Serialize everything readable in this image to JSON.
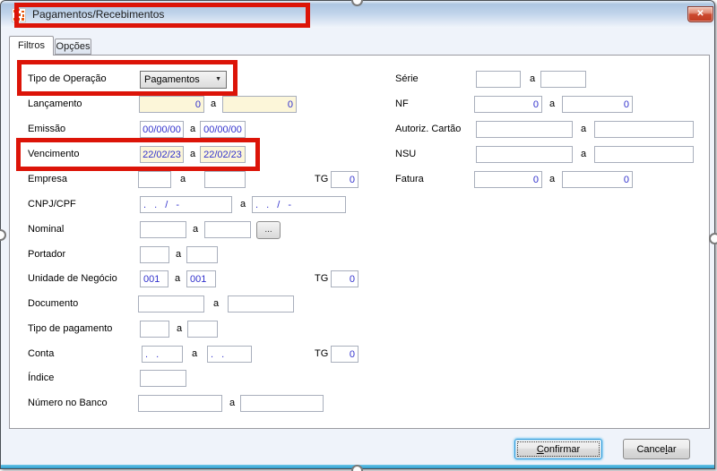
{
  "window": {
    "title": "Pagamentos/Recebimentos"
  },
  "tabs": [
    {
      "label": "Filtros",
      "active": true
    },
    {
      "label": "Opções",
      "active": false
    }
  ],
  "labels": {
    "range_separator": "a",
    "tg": "TG"
  },
  "icons": {
    "close": "✕",
    "dropdown_arrow": "▼",
    "app_icon": "orange-dots-logo"
  },
  "left_rows": [
    {
      "label": "Tipo de Operação",
      "value": "Pagamentos"
    },
    {
      "label": "Lançamento",
      "f1": "0",
      "f2": "0"
    },
    {
      "label": "Emissão",
      "f1": "00/00/00",
      "f2": "00/00/00"
    },
    {
      "label": "Vencimento",
      "f1": "22/02/23",
      "f2": "22/02/23"
    },
    {
      "label": "Empresa",
      "f1": "",
      "f2": "",
      "tg": "0"
    },
    {
      "label": "CNPJ/CPF",
      "f1": ". . / -",
      "f2": ". . / -"
    },
    {
      "label": "Nominal",
      "f1": "",
      "f2": "",
      "browse": "..."
    },
    {
      "label": "Portador",
      "f1": "",
      "f2": ""
    },
    {
      "label": "Unidade de Negócio",
      "f1": "001",
      "f2": "001",
      "tg": "0"
    },
    {
      "label": "Documento",
      "f1": "",
      "f2": ""
    },
    {
      "label": "Tipo de pagamento",
      "f1": "",
      "f2": ""
    },
    {
      "label": "Conta",
      "f1": ". .",
      "f2": ". .",
      "tg": "0"
    },
    {
      "label": "Índice",
      "f1": ""
    },
    {
      "label": "Número no Banco",
      "f1": "",
      "f2": ""
    }
  ],
  "right_rows": [
    {
      "label": "Série",
      "f1": "",
      "f2": ""
    },
    {
      "label": "NF",
      "f1": "0",
      "f2": "0"
    },
    {
      "label": "Autoriz. Cartão",
      "f1": "",
      "f2": ""
    },
    {
      "label": "NSU",
      "f1": "",
      "f2": ""
    },
    {
      "label": "Fatura",
      "f1": "0",
      "f2": "0"
    }
  ],
  "buttons": {
    "confirm": {
      "pre": "",
      "key": "C",
      "post": "onfirmar"
    },
    "cancel": {
      "pre": "Cance",
      "key": "l",
      "post": "ar"
    }
  },
  "colors": {
    "highlight_red": "#dc1408",
    "field_text_blue": "#3232cd",
    "cream_field_bg": "#fcf6d9",
    "titlebar_blue": "#b3cbe5",
    "bottom_border_blue": "#3aa7d4",
    "close_button_red": "#c03c22"
  }
}
